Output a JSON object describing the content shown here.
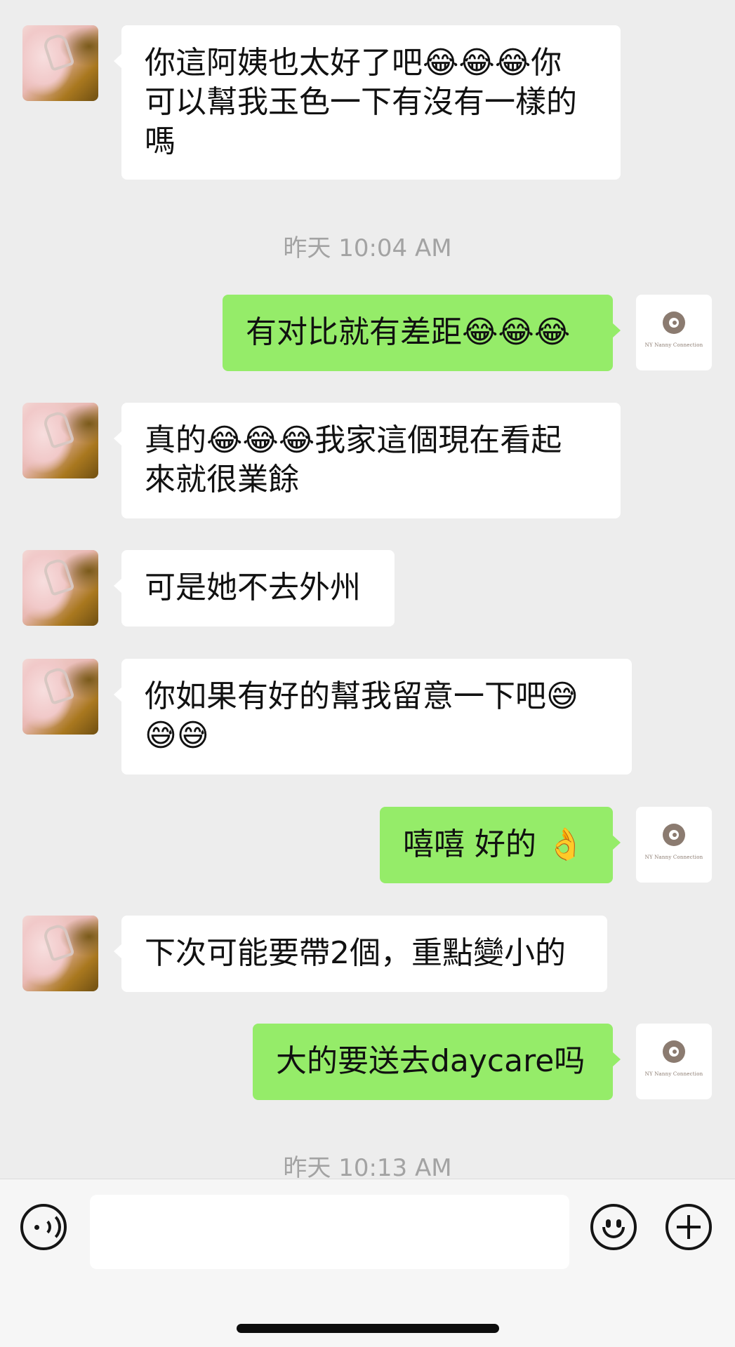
{
  "messages": [
    {
      "side": "in",
      "text": "你這阿姨也太好了吧😂😂😂你\n可以幫我玉色一下有沒有一樣的\n嗎"
    },
    {
      "side": "ts",
      "text": "昨天 10:04 AM"
    },
    {
      "side": "out",
      "text": "有对比就有差距😂😂😂"
    },
    {
      "side": "in",
      "text": "真的😂😂😂我家這個現在看起\n來就很業餘"
    },
    {
      "side": "in",
      "text": "可是她不去外州"
    },
    {
      "side": "in",
      "text": "你如果有好的幫我留意一下吧😅\n😅😅"
    },
    {
      "side": "out",
      "text": "嘻嘻 好的 👌"
    },
    {
      "side": "in",
      "text": "下次可能要帶2個，重點變小的"
    },
    {
      "side": "out",
      "text": "大的要送去daycare吗"
    },
    {
      "side": "ts",
      "text": "昨天 10:13 AM"
    }
  ],
  "my_avatar_caption": "NY Nanny Connection",
  "input": {
    "value": "",
    "placeholder": ""
  },
  "icons": [
    "voice-icon",
    "emoji-icon",
    "plus-icon"
  ],
  "colors": {
    "background": "#ededed",
    "incoming_bubble": "#ffffff",
    "outgoing_bubble": "#95ec69",
    "timestamp": "#a3a3a3"
  }
}
